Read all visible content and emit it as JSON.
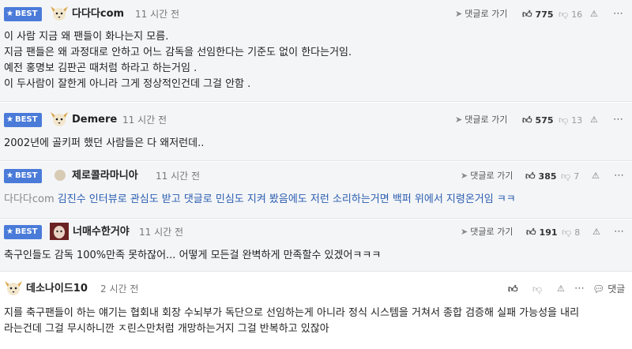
{
  "best_label": "BEST",
  "reply_label": "댓글로 가기",
  "comments": [
    {
      "best": true,
      "nick": "다다다com",
      "time": "11 시간 전",
      "up": "775",
      "down": "16",
      "avatar": "fox-avatar-icon",
      "lines": [
        "이 사람 지금 왜 팬들이 화나는지 모름.",
        "지금 팬들은 왜 과정대로 안하고 어느 감독을 선임한다는 기준도 없이 한다는거임.",
        "예전 홍명보 김판곤 때처럼 하라고 하는거임 .",
        "이 두사람이 잘한게 아니라 그게 정상적인건데 그걸 안함 ."
      ]
    },
    {
      "best": true,
      "nick": "Demere",
      "time": "11 시간 전",
      "up": "575",
      "down": "13",
      "avatar": "fox-avatar-icon",
      "lines": [
        "2002년에 골키퍼 했던 사람들은 다 왜저런데.."
      ]
    },
    {
      "best": true,
      "nick": "제로콜라마니아",
      "time": "11 시간 전",
      "up": "385",
      "down": "7",
      "avatar": "default-avatar-icon",
      "ref_nick": "다다다com",
      "lines": [
        "김진수 인터뷰로 관심도 받고 댓글로 민심도 지켜 봤음에도 저런 소리하는거면 백퍼 위에서 지령온거임 ㅋㅋ"
      ]
    },
    {
      "best": true,
      "nick": "너매수한거야",
      "time": "11 시간 전",
      "up": "191",
      "down": "8",
      "avatar": "photo-avatar-icon",
      "lines": [
        "축구인들도 감독 100%만족 못하잖어... 어떻게 모든걸 완벽하게 만족할수 있겠어ㅋㅋㅋ"
      ]
    },
    {
      "best": false,
      "nick": "데소나이드10",
      "time": "2 시간 전",
      "reply_label": "댓글",
      "avatar": "fox-avatar-icon",
      "lines": [
        "지를 축구팬들이 하는 얘기는 협회내 회장 수뇌부가 독단으로 선임하는게 아니라 정식 시스템을 거쳐서 종합 검증해 실패 가능성을 내리",
        "라는건데 그걸 무시하니깐 ㅈ린스만처럼 개망하는거지 그걸 반복하고 있잖아"
      ]
    }
  ]
}
